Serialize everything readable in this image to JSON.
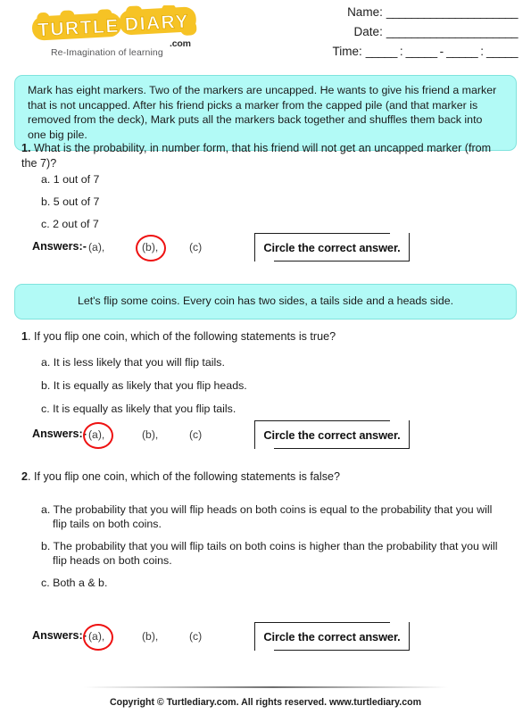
{
  "header": {
    "logo": {
      "text": "TURTLE DIARY",
      "word1": "TURTLE",
      "word2": "DIARY",
      "dotcom": ".com",
      "tagline": "Re-Imagination of learning",
      "color": "#f6c325"
    },
    "fields": {
      "name_label": "Name:",
      "name_blank": "_____________________",
      "date_label": "Date:",
      "date_blank": "_____________________",
      "time_label": "Time:",
      "time_blank_1": "_____",
      "time_sep_1": ":",
      "time_blank_2": "_____",
      "time_sep_2": "-",
      "time_blank_3": "_____",
      "time_sep_3": ":",
      "time_blank_4": "_____"
    }
  },
  "sections": [
    {
      "passage": "Mark has eight markers. Two of the markers are uncapped. He wants to give his friend a marker that is not uncapped. After his friend picks a marker from the capped pile (and that marker is removed from the deck), Mark puts all the markers back together and shuffles them back into one big pile.",
      "questions": [
        {
          "number": "1",
          "number_suffix": ".",
          "stem": "What is the probability, in number form, that his friend will not get an uncapped marker (from the 7)?",
          "options": [
            "a. 1 out of 7",
            "b. 5 out of 7",
            "c. 2 out of 7"
          ],
          "answers_label": "Answers:-",
          "answer_options": [
            "(a),",
            "(b),",
            "(c)"
          ],
          "circled": "b",
          "circle_color": "#ee1111",
          "instruction": "Circle the correct answer."
        }
      ]
    },
    {
      "passage": "Let's flip some coins. Every coin has two sides, a tails side and a heads side.",
      "questions": [
        {
          "number": "1",
          "number_suffix": ".",
          "stem": "If you flip one coin, which of the following statements is true?",
          "options": [
            "a. It is less likely that you will flip tails.",
            "b. It is equally as likely that you flip heads.",
            "c. It is equally as likely that you flip tails."
          ],
          "answers_label": "Answers:-",
          "answer_options": [
            "(a),",
            "(b),",
            "(c)"
          ],
          "circled": "a",
          "circle_color": "#ee1111",
          "instruction": "Circle the correct answer."
        },
        {
          "number": "2",
          "number_suffix": ".",
          "stem": "If you flip one coin, which of the following statements is false?",
          "options": [
            "a. The probability that you will flip heads on both coins is equal to the probability that you will flip tails on both coins.",
            "b. The probability that you will flip tails on both coins is higher than the probability that you will flip heads on both coins.",
            "c. Both a & b."
          ],
          "answers_label": "Answers:-",
          "answer_options": [
            "(a),",
            "(b),",
            "(c)"
          ],
          "circled": "a",
          "circle_color": "#ee1111",
          "instruction": "Circle the correct answer."
        }
      ]
    }
  ],
  "footer": {
    "copyright": "Copyright © Turtlediary.com. All rights reserved. www.turtlediary.com"
  }
}
